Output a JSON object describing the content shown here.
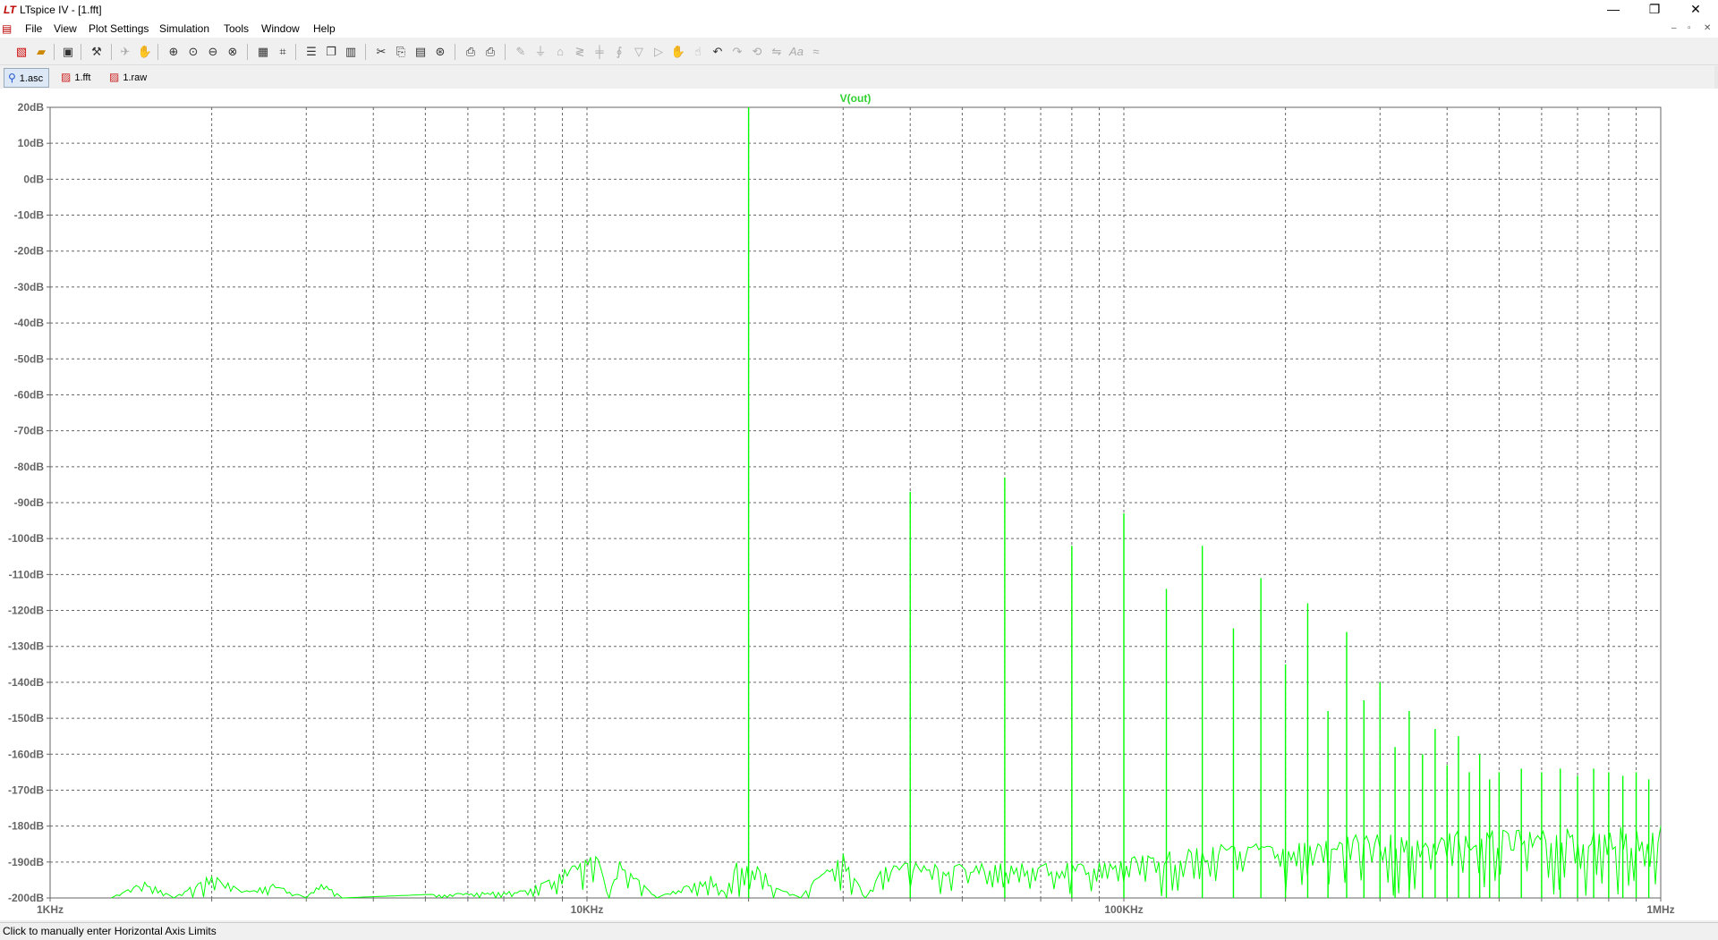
{
  "window": {
    "app_icon": "LT",
    "title": "LTspice IV - [1.fft]",
    "minimize": "—",
    "maximize": "❐",
    "close": "✕"
  },
  "menu": {
    "items": [
      "File",
      "View",
      "Plot Settings",
      "Simulation",
      "Tools",
      "Window",
      "Help"
    ],
    "mdi_min": "–",
    "mdi_restore": "▫",
    "mdi_close": "✕"
  },
  "toolbar": {
    "icons": [
      "new-schematic-icon",
      "open-icon",
      "save-icon",
      "control-panel-icon",
      "run-icon",
      "pause-icon",
      "zoom-in-icon",
      "zoom-full-icon",
      "zoom-out-icon",
      "zoom-cancel-icon",
      "autorange-icon",
      "cursor-icon",
      "tile-horizontal-icon",
      "cascade-icon",
      "tile-vertical-icon",
      "cut-icon",
      "copy-icon",
      "paste-icon",
      "find-icon",
      "print-preview-icon",
      "print-icon",
      "wire-icon",
      "ground-icon",
      "label-icon",
      "resistor-icon",
      "capacitor-icon",
      "inductor-icon",
      "diode-icon",
      "component-icon",
      "move-icon",
      "drag-icon",
      "undo-icon",
      "redo-icon",
      "rotate-icon",
      "mirror-icon",
      "text-icon",
      "spice-directive-icon"
    ]
  },
  "tabs": [
    {
      "label": "1.asc",
      "icon": "schematic-tab-icon"
    },
    {
      "label": "1.fft",
      "icon": "waveform-tab-icon"
    },
    {
      "label": "1.raw",
      "icon": "waveform-tab-icon"
    }
  ],
  "colors": {
    "trace": "#00ff00",
    "grid": "#666666",
    "axis_text": "#666666",
    "trace_title": "#2ed12e"
  },
  "chart_data": {
    "type": "line",
    "title": "V(out)",
    "x_scale": "log",
    "xlim": [
      1000,
      1000000
    ],
    "ylim": [
      -200,
      20
    ],
    "x_tick_labels": [
      {
        "value": 1000,
        "label": "1KHz"
      },
      {
        "value": 10000,
        "label": "10KHz"
      },
      {
        "value": 100000,
        "label": "100KHz"
      },
      {
        "value": 1000000,
        "label": "1MHz"
      }
    ],
    "y_ticks": [
      20,
      10,
      0,
      -10,
      -20,
      -30,
      -40,
      -50,
      -60,
      -70,
      -80,
      -90,
      -100,
      -110,
      -120,
      -130,
      -140,
      -150,
      -160,
      -170,
      -180,
      -190,
      -200
    ],
    "y_tick_labels": [
      "20dB",
      "10dB",
      "0dB",
      "-10dB",
      "-20dB",
      "-30dB",
      "-40dB",
      "-50dB",
      "-60dB",
      "-70dB",
      "-80dB",
      "-90dB",
      "-100dB",
      "-110dB",
      "-120dB",
      "-130dB",
      "-140dB",
      "-150dB",
      "-160dB",
      "-170dB",
      "-180dB",
      "-190dB",
      "-200dB"
    ],
    "grid": true,
    "series": [
      {
        "name": "V(out)",
        "peaks": [
          {
            "x": 20000,
            "y": 20
          },
          {
            "x": 40000,
            "y": -87
          },
          {
            "x": 60000,
            "y": -83
          },
          {
            "x": 80000,
            "y": -102
          },
          {
            "x": 100000,
            "y": -93
          },
          {
            "x": 120000,
            "y": -114
          },
          {
            "x": 140000,
            "y": -102
          },
          {
            "x": 160000,
            "y": -125
          },
          {
            "x": 180000,
            "y": -111
          },
          {
            "x": 200000,
            "y": -135
          },
          {
            "x": 220000,
            "y": -118
          },
          {
            "x": 240000,
            "y": -148
          },
          {
            "x": 260000,
            "y": -126
          },
          {
            "x": 280000,
            "y": -145
          },
          {
            "x": 300000,
            "y": -140
          },
          {
            "x": 320000,
            "y": -158
          },
          {
            "x": 340000,
            "y": -148
          },
          {
            "x": 360000,
            "y": -160
          },
          {
            "x": 380000,
            "y": -153
          },
          {
            "x": 400000,
            "y": -163
          },
          {
            "x": 420000,
            "y": -155
          },
          {
            "x": 440000,
            "y": -165
          },
          {
            "x": 460000,
            "y": -160
          },
          {
            "x": 480000,
            "y": -167
          },
          {
            "x": 500000,
            "y": -165
          },
          {
            "x": 550000,
            "y": -164
          },
          {
            "x": 600000,
            "y": -165
          },
          {
            "x": 650000,
            "y": -164
          },
          {
            "x": 700000,
            "y": -166
          },
          {
            "x": 750000,
            "y": -164
          },
          {
            "x": 800000,
            "y": -165
          },
          {
            "x": 850000,
            "y": -166
          },
          {
            "x": 900000,
            "y": -165
          },
          {
            "x": 950000,
            "y": -167
          }
        ],
        "noise_floor": [
          {
            "x": 1300,
            "y": -200
          },
          {
            "x": 1500,
            "y": -195
          },
          {
            "x": 1700,
            "y": -200
          },
          {
            "x": 2000,
            "y": -193
          },
          {
            "x": 2300,
            "y": -198
          },
          {
            "x": 2600,
            "y": -196
          },
          {
            "x": 3000,
            "y": -200
          },
          {
            "x": 3200,
            "y": -195
          },
          {
            "x": 3500,
            "y": -200
          },
          {
            "x": 7500,
            "y": -198
          },
          {
            "x": 8500,
            "y": -195
          },
          {
            "x": 9500,
            "y": -190
          },
          {
            "x": 10500,
            "y": -188
          },
          {
            "x": 11000,
            "y": -200
          },
          {
            "x": 11500,
            "y": -187
          },
          {
            "x": 12500,
            "y": -195
          },
          {
            "x": 13500,
            "y": -200
          },
          {
            "x": 17000,
            "y": -193
          },
          {
            "x": 18000,
            "y": -198
          },
          {
            "x": 19000,
            "y": -190
          },
          {
            "x": 21000,
            "y": -190
          },
          {
            "x": 22000,
            "y": -196
          },
          {
            "x": 25000,
            "y": -200
          },
          {
            "x": 28000,
            "y": -190
          },
          {
            "x": 30000,
            "y": -187
          },
          {
            "x": 33000,
            "y": -200
          },
          {
            "x": 36000,
            "y": -190
          },
          {
            "x": 45000,
            "y": -190
          },
          {
            "x": 55000,
            "y": -190
          },
          {
            "x": 70000,
            "y": -190
          },
          {
            "x": 90000,
            "y": -190
          },
          {
            "x": 150000,
            "y": -185
          },
          {
            "x": 300000,
            "y": -182
          },
          {
            "x": 1000000,
            "y": -180
          }
        ]
      }
    ]
  },
  "status": {
    "text": "Click to manually enter Horizontal Axis Limits"
  }
}
